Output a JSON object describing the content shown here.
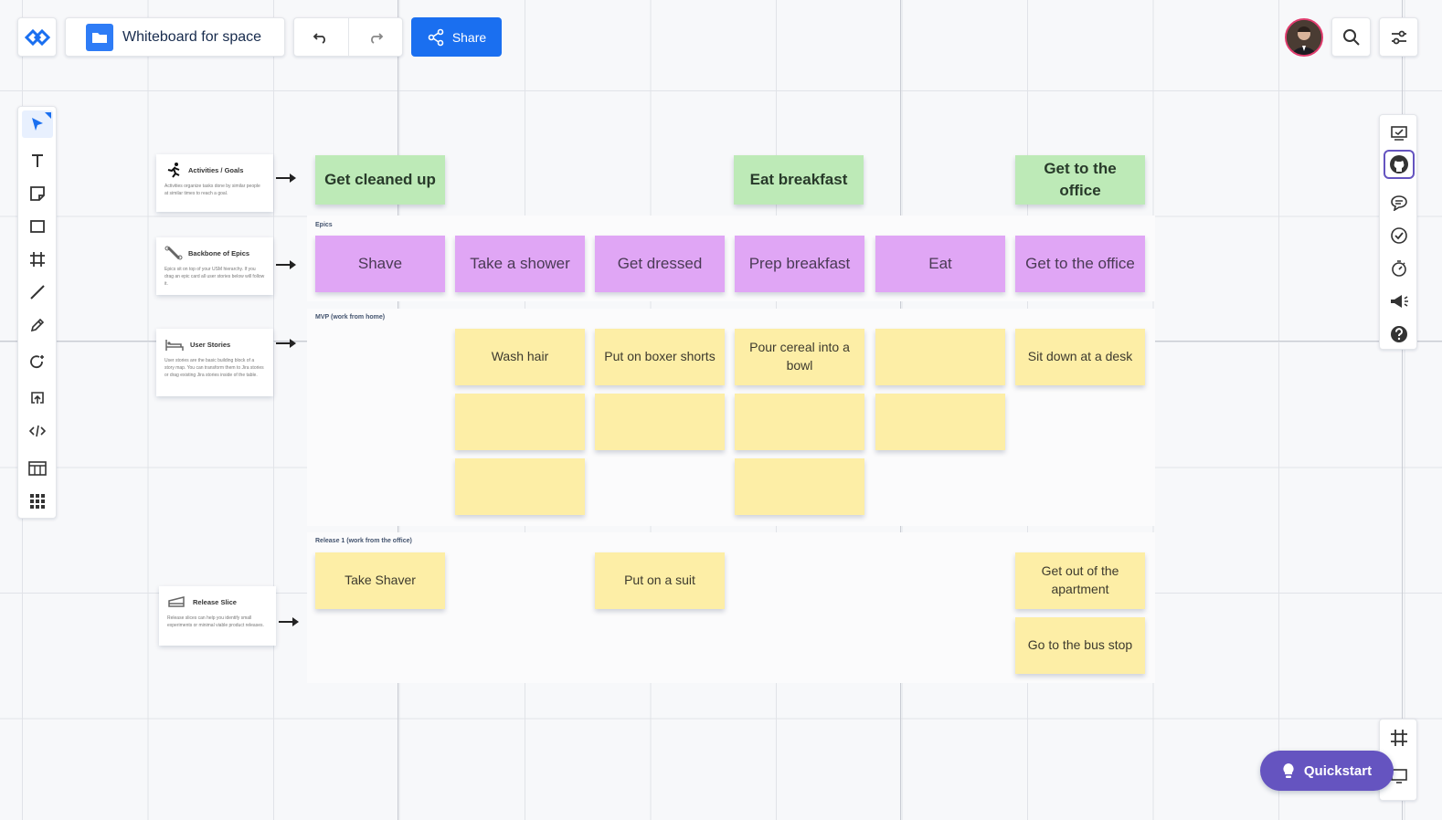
{
  "app": {
    "board_title": "Whiteboard for space",
    "share_label": "Share"
  },
  "quickstart_label": "Quickstart",
  "colors": {
    "accent": "#1a6ff0",
    "quickstart": "#6554c0",
    "green_note": "#bdeab7",
    "purple_note": "#e0a6f5",
    "yellow_note": "#fdeea6"
  },
  "legend": {
    "activities": {
      "title": "Activities / Goals",
      "body": "Activities organize tasks done by similar people at similar times to reach a goal."
    },
    "backbone": {
      "title": "Backbone of Epics",
      "body": "Epics sit on top of your USM hierarchy. If you drag an epic card all user stories below will follow it."
    },
    "stories": {
      "title": "User Stories",
      "body": "User stories are the basic building block of a story map. You can transform them to Jira stories or drag existing Jira stories inside of the table."
    },
    "release": {
      "title": "Release Slice",
      "body": "Release slices can help you identify small experiments or minimal viable product releases."
    }
  },
  "sections": {
    "epics": "Epics",
    "mvp": "MVP (work from home)",
    "release1": "Release 1 (work from the office)"
  },
  "activities": [
    "Get cleaned up",
    "Eat breakfast",
    "Get to the office"
  ],
  "epics": [
    "Shave",
    "Take a shower",
    "Get dressed",
    "Prep breakfast",
    "Eat",
    "Get to the office"
  ],
  "mvp_stories": [
    "Wash hair",
    "Put on boxer shorts",
    "Pour cereal into a bowl",
    "",
    "Sit down at a desk"
  ],
  "release_stories": [
    "Take Shaver",
    "Put on a suit",
    "Get out of the apartment",
    "Go to the bus stop"
  ],
  "icons": {
    "logo": "whiteboard-logo-icon",
    "folder": "folder-icon",
    "undo": "undo-icon",
    "redo": "redo-icon",
    "share": "share-icon",
    "search": "search-icon",
    "settings": "sliders-icon",
    "tools": [
      "select-icon",
      "text-icon",
      "sticky-note-icon",
      "rectangle-icon",
      "frame-icon",
      "line-icon",
      "pen-icon",
      "lasso-icon",
      "upload-icon",
      "embed-code-icon",
      "table-icon",
      "apps-grid-icon"
    ],
    "right_tools": [
      "presentation-icon",
      "github-icon",
      "comment-icon",
      "checklist-icon",
      "timer-icon",
      "announce-icon",
      "help-icon"
    ]
  }
}
